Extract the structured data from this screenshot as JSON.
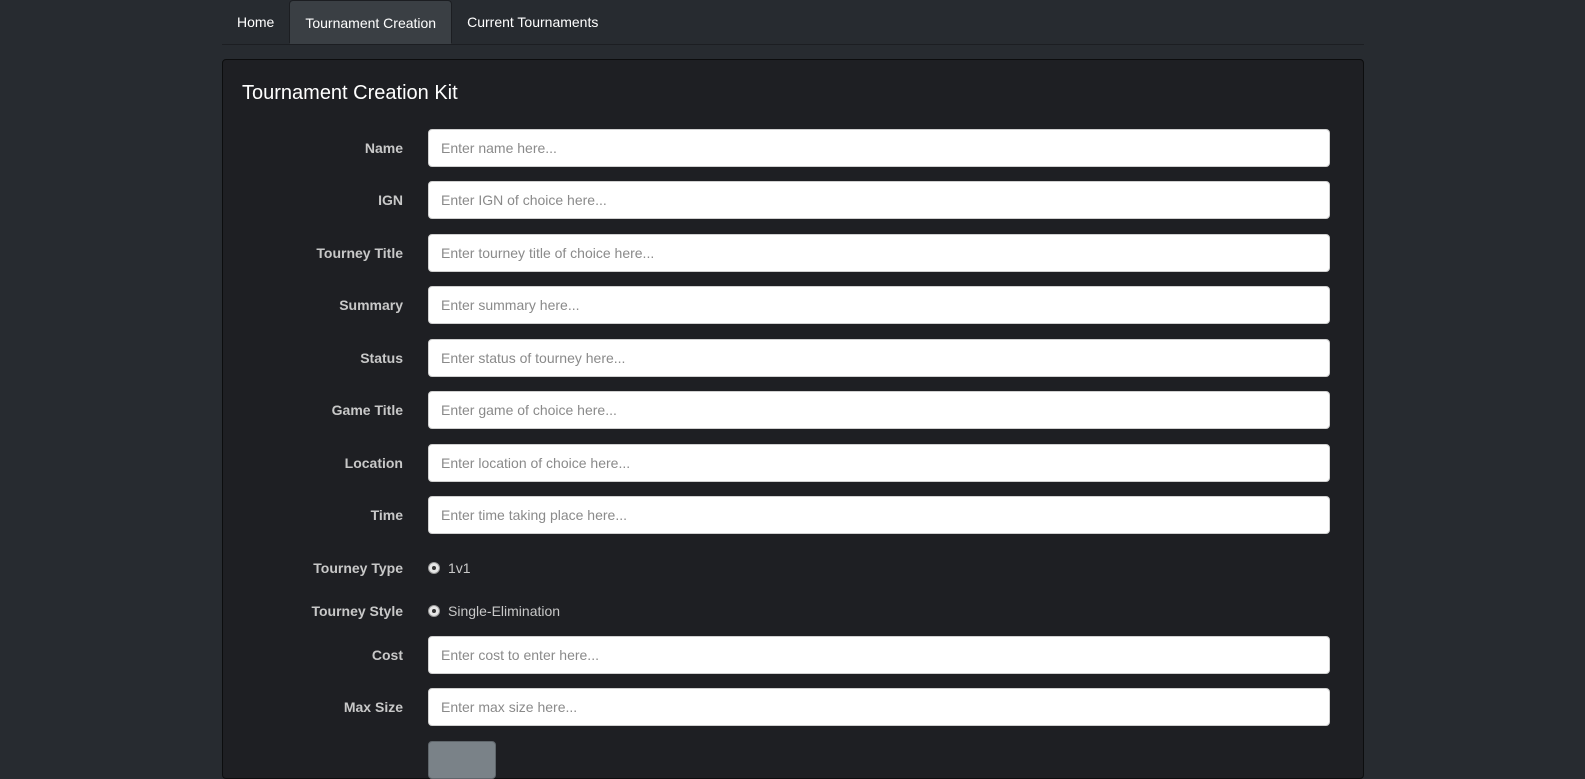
{
  "nav": {
    "tabs": [
      {
        "label": "Home"
      },
      {
        "label": "Tournament Creation"
      },
      {
        "label": "Current Tournaments"
      }
    ]
  },
  "panel": {
    "title": "Tournament Creation Kit"
  },
  "form": {
    "name": {
      "label": "Name",
      "placeholder": "Enter name here..."
    },
    "ign": {
      "label": "IGN",
      "placeholder": "Enter IGN of choice here..."
    },
    "tourney_title": {
      "label": "Tourney Title",
      "placeholder": "Enter tourney title of choice here..."
    },
    "summary": {
      "label": "Summary",
      "placeholder": "Enter summary here..."
    },
    "status": {
      "label": "Status",
      "placeholder": "Enter status of tourney here..."
    },
    "game_title": {
      "label": "Game Title",
      "placeholder": "Enter game of choice here..."
    },
    "location": {
      "label": "Location",
      "placeholder": "Enter location of choice here..."
    },
    "time": {
      "label": "Time",
      "placeholder": "Enter time taking place here..."
    },
    "tourney_type": {
      "label": "Tourney Type",
      "option": "1v1"
    },
    "tourney_style": {
      "label": "Tourney Style",
      "option": "Single-Elimination"
    },
    "cost": {
      "label": "Cost",
      "placeholder": "Enter cost to enter here..."
    },
    "max_size": {
      "label": "Max Size",
      "placeholder": "Enter max size here..."
    }
  }
}
